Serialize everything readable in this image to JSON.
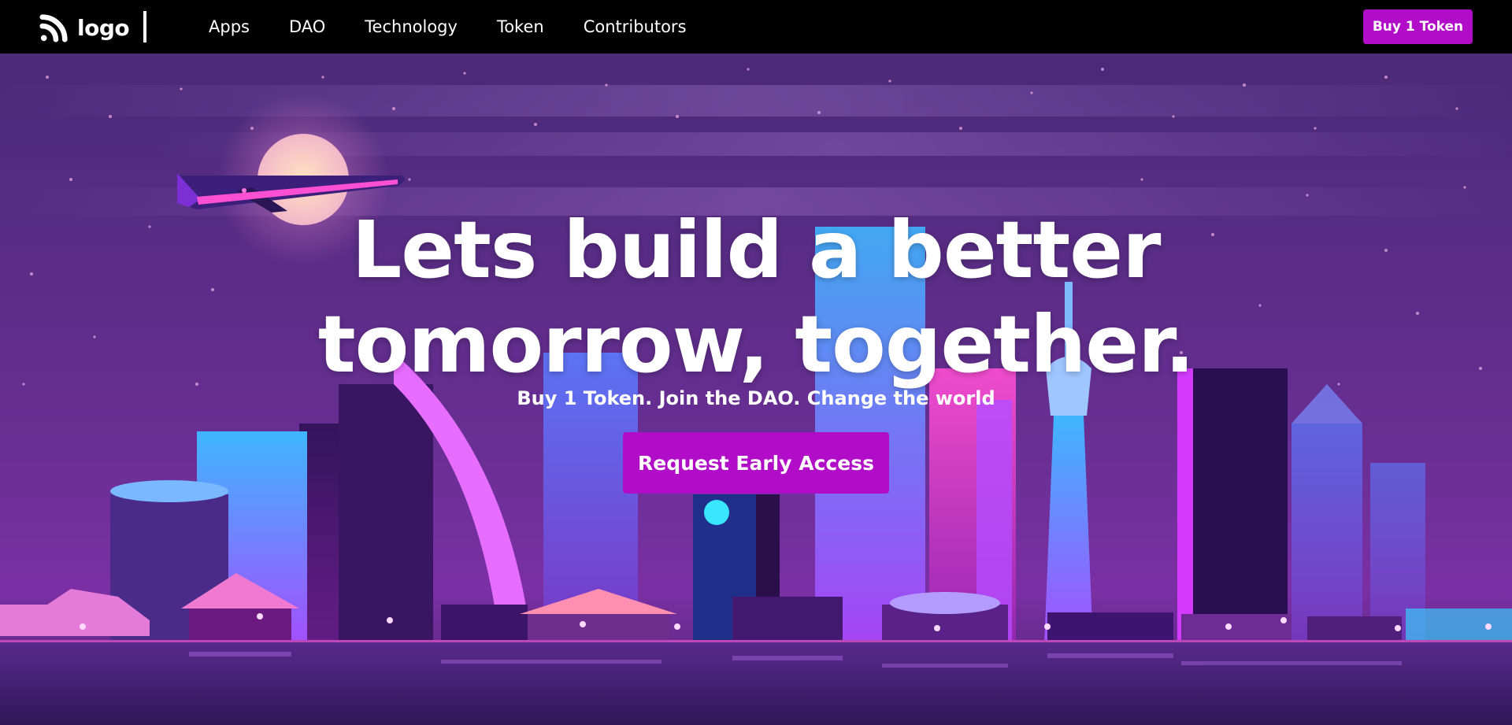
{
  "brand": {
    "logo_text": "logo",
    "logo_icon": "rss-waves-icon"
  },
  "nav": {
    "links": [
      "Apps",
      "DAO",
      "Technology",
      "Token",
      "Contributors"
    ]
  },
  "header": {
    "buy_label": "Buy 1 Token"
  },
  "hero": {
    "headline_line1": "Lets build a better",
    "headline_line2": "tomorrow, together.",
    "subheadline": "Buy 1 Token. Join the DAO. Change the world",
    "cta_label": "Request Early Access"
  },
  "colors": {
    "accent": "#b10cc7",
    "nav_bg": "#000000",
    "sky_top": "#4b2a78",
    "sky_bottom": "#7b2fa4"
  }
}
